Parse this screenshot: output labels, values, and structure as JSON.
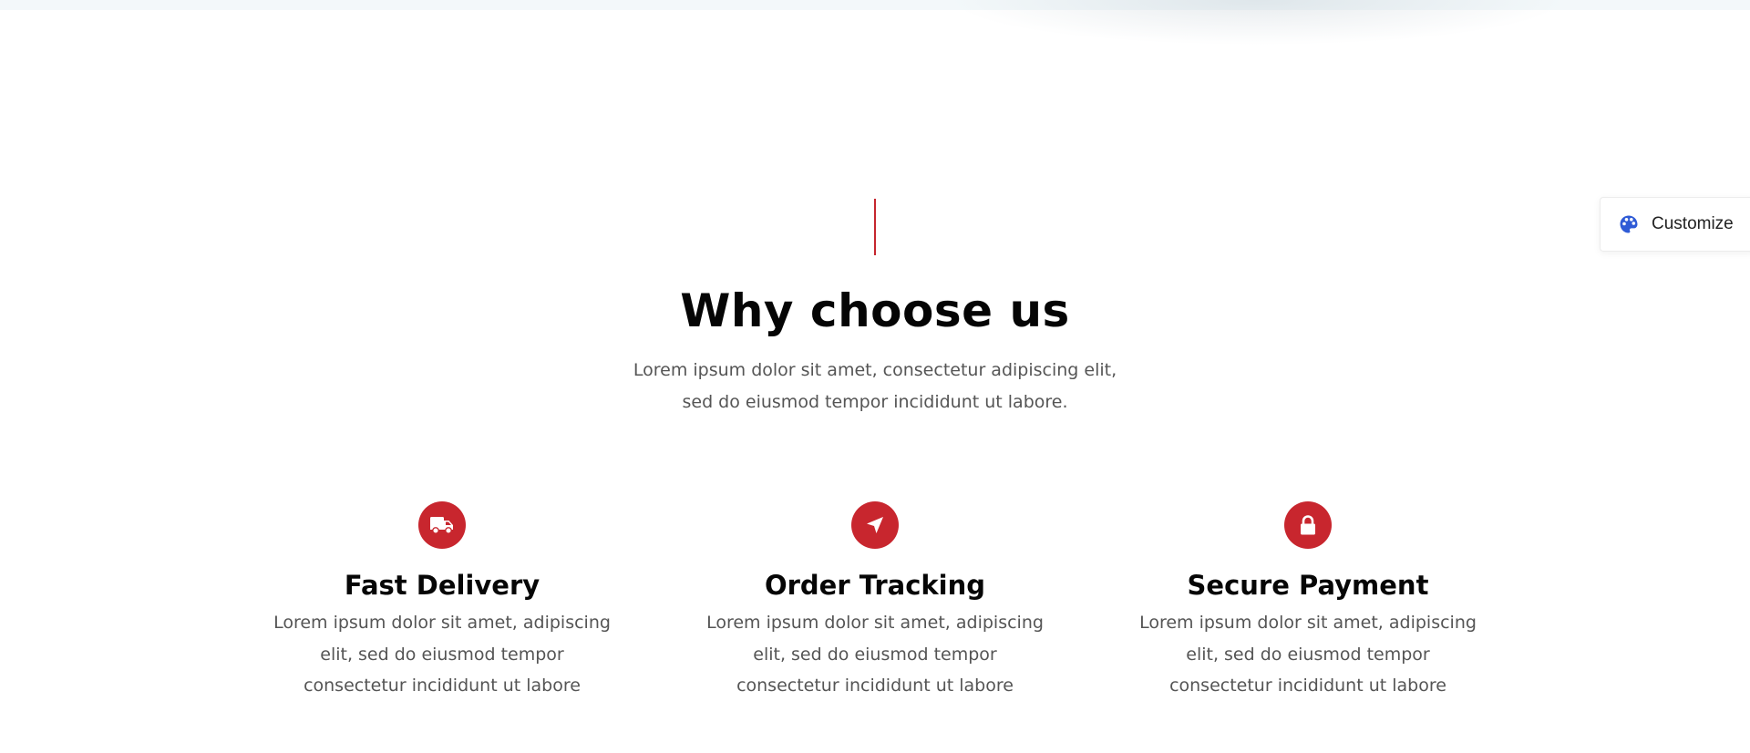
{
  "section": {
    "heading": "Why choose us",
    "subtitle": "Lorem ipsum dolor sit amet, consectetur adipiscing elit, sed do eiusmod tempor incididunt ut labore."
  },
  "features": [
    {
      "icon": "truck-icon",
      "title": "Fast Delivery",
      "text": "Lorem ipsum dolor sit amet, adipiscing elit, sed do eiusmod tempor consectetur incididunt ut labore"
    },
    {
      "icon": "location-arrow-icon",
      "title": "Order Tracking",
      "text": "Lorem ipsum dolor sit amet, adipiscing elit, sed do eiusmod tempor consectetur incididunt ut labore"
    },
    {
      "icon": "lock-icon",
      "title": "Secure Payment",
      "text": "Lorem ipsum dolor sit amet, adipiscing elit, sed do eiusmod tempor consectetur incididunt ut labore"
    }
  ],
  "customize": {
    "label": "Customize",
    "icon": "palette-icon"
  },
  "colors": {
    "accent": "#c8262e",
    "customize_icon": "#2f5bd6"
  }
}
